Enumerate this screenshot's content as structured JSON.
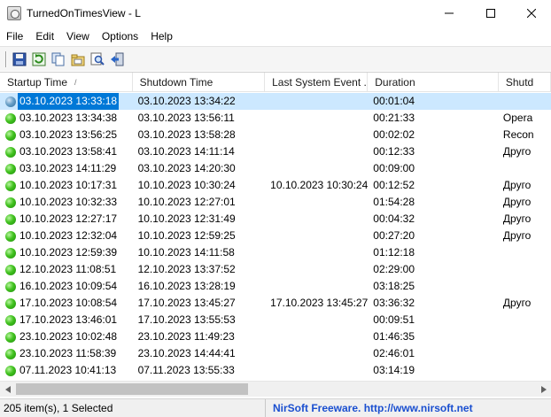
{
  "window": {
    "title": "TurnedOnTimesView  -  L"
  },
  "menu": [
    "File",
    "Edit",
    "View",
    "Options",
    "Help"
  ],
  "toolbar": {
    "buttons": [
      "save-icon",
      "refresh-icon",
      "copy-icon",
      "properties-icon",
      "find-icon",
      "exit-icon"
    ]
  },
  "list": {
    "columns": [
      "Startup Time",
      "Shutdown Time",
      "Last System Event ...",
      "Duration",
      "Shutd"
    ],
    "sort_indicator": "/",
    "rows": [
      {
        "startup": "03.10.2023 13:33:18",
        "shutdown": "03.10.2023 13:34:22",
        "last_event": "",
        "duration": "00:01:04",
        "reason": "",
        "selected": true
      },
      {
        "startup": "03.10.2023 13:34:38",
        "shutdown": "03.10.2023 13:56:11",
        "last_event": "",
        "duration": "00:21:33",
        "reason": "Opera"
      },
      {
        "startup": "03.10.2023 13:56:25",
        "shutdown": "03.10.2023 13:58:28",
        "last_event": "",
        "duration": "00:02:02",
        "reason": "Recon"
      },
      {
        "startup": "03.10.2023 13:58:41",
        "shutdown": "03.10.2023 14:11:14",
        "last_event": "",
        "duration": "00:12:33",
        "reason": "Друго"
      },
      {
        "startup": "03.10.2023 14:11:29",
        "shutdown": "03.10.2023 14:20:30",
        "last_event": "",
        "duration": "00:09:00",
        "reason": ""
      },
      {
        "startup": "10.10.2023 10:17:31",
        "shutdown": "10.10.2023 10:30:24",
        "last_event": "10.10.2023 10:30:24",
        "duration": "00:12:52",
        "reason": "Друго"
      },
      {
        "startup": "10.10.2023 10:32:33",
        "shutdown": "10.10.2023 12:27:01",
        "last_event": "",
        "duration": "01:54:28",
        "reason": "Друго"
      },
      {
        "startup": "10.10.2023 12:27:17",
        "shutdown": "10.10.2023 12:31:49",
        "last_event": "",
        "duration": "00:04:32",
        "reason": "Друго"
      },
      {
        "startup": "10.10.2023 12:32:04",
        "shutdown": "10.10.2023 12:59:25",
        "last_event": "",
        "duration": "00:27:20",
        "reason": "Друго"
      },
      {
        "startup": "10.10.2023 12:59:39",
        "shutdown": "10.10.2023 14:11:58",
        "last_event": "",
        "duration": "01:12:18",
        "reason": ""
      },
      {
        "startup": "12.10.2023 11:08:51",
        "shutdown": "12.10.2023 13:37:52",
        "last_event": "",
        "duration": "02:29:00",
        "reason": ""
      },
      {
        "startup": "16.10.2023 10:09:54",
        "shutdown": "16.10.2023 13:28:19",
        "last_event": "",
        "duration": "03:18:25",
        "reason": ""
      },
      {
        "startup": "17.10.2023 10:08:54",
        "shutdown": "17.10.2023 13:45:27",
        "last_event": "17.10.2023 13:45:27",
        "duration": "03:36:32",
        "reason": "Друго"
      },
      {
        "startup": "17.10.2023 13:46:01",
        "shutdown": "17.10.2023 13:55:53",
        "last_event": "",
        "duration": "00:09:51",
        "reason": ""
      },
      {
        "startup": "23.10.2023 10:02:48",
        "shutdown": "23.10.2023 11:49:23",
        "last_event": "",
        "duration": "01:46:35",
        "reason": ""
      },
      {
        "startup": "23.10.2023 11:58:39",
        "shutdown": "23.10.2023 14:44:41",
        "last_event": "",
        "duration": "02:46:01",
        "reason": ""
      },
      {
        "startup": "07.11.2023 10:41:13",
        "shutdown": "07.11.2023 13:55:33",
        "last_event": "",
        "duration": "03:14:19",
        "reason": ""
      }
    ]
  },
  "status": {
    "count": "205 item(s), 1 Selected",
    "credit": "NirSoft Freeware.  http://www.nirsoft.net"
  },
  "colors": {
    "selection": "#0078d7",
    "selection_row": "#cce8ff",
    "link": "#1a4fd0",
    "status_on": "#41c21e"
  }
}
